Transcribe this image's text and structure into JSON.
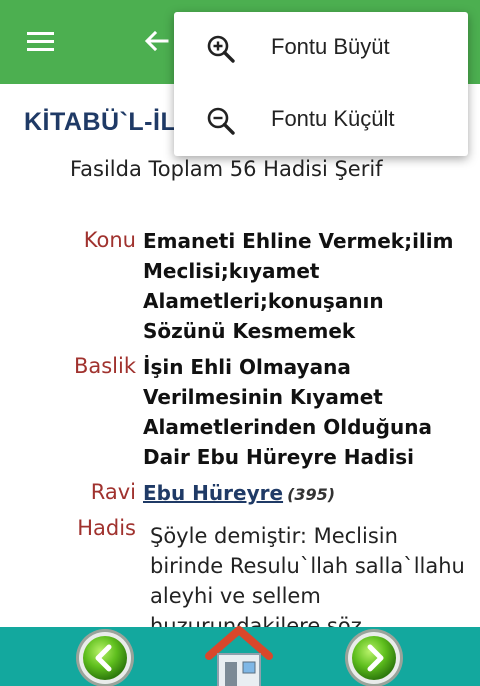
{
  "toolbar": {
    "menu_icon": "hamburger-menu-icon",
    "back_icon": "arrow-left-icon",
    "color": "#4caf50"
  },
  "page": {
    "title": "KİTABÜ`L-İL",
    "subtitle": "Fasilda Toplam 56 Hadisi Şerif"
  },
  "entry": {
    "konu_label": "Konu",
    "konu_value": "Emaneti Ehline Vermek;ilim Meclisi;kıyamet Alametleri;konuşanın Sözünü Kesmemek",
    "baslik_label": "Baslik",
    "baslik_value": "İşin Ehli Olmayana Verilmesinin Kıyamet Alametlerinden Olduğuna Dair Ebu Hüreyre Hadisi",
    "ravi_label": "Ravi",
    "ravi_name": "Ebu Hüreyre",
    "ravi_count": "(395)",
    "hadis_label": "Hadis",
    "hadis_text": "Şöyle demiştir: Meclisin birinde Resulu`llah salla`llahu aleyhi ve sellem huzurundakilere söz"
  },
  "menu": {
    "items": [
      {
        "label": "Fontu Büyüt",
        "icon": "zoom-in-icon"
      },
      {
        "label": "Fontu Küçült",
        "icon": "zoom-out-icon"
      }
    ]
  },
  "bottom": {
    "prev_icon": "chevron-left-icon",
    "home_icon": "home-icon",
    "next_icon": "chevron-right-icon",
    "color": "#13a89e"
  }
}
